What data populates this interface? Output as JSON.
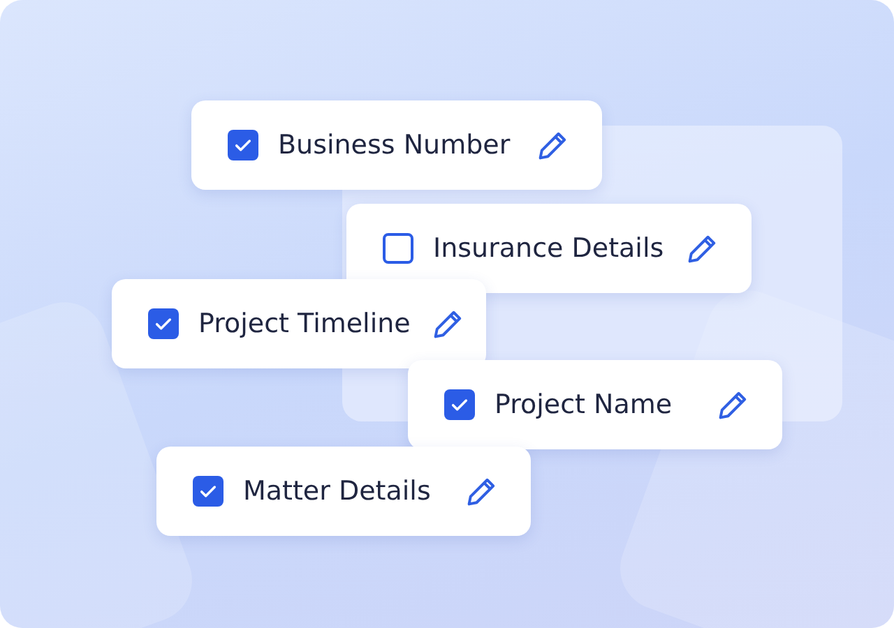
{
  "fields": [
    {
      "label": "Business Number",
      "checked": true
    },
    {
      "label": "Insurance Details",
      "checked": false
    },
    {
      "label": "Project Timeline",
      "checked": true
    },
    {
      "label": "Project Name",
      "checked": true
    },
    {
      "label": "Matter Details",
      "checked": true
    }
  ]
}
